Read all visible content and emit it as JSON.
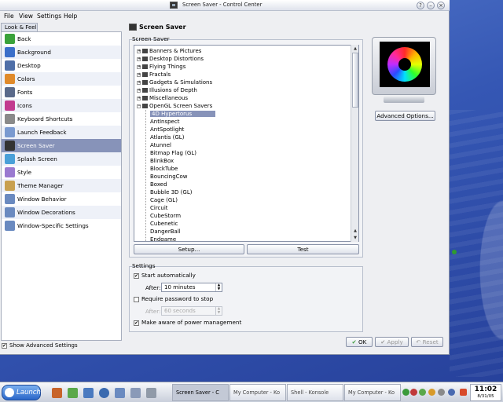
{
  "window": {
    "title": "Screen Saver - Control Center"
  },
  "menu": [
    "File",
    "View",
    "Settings",
    "Help"
  ],
  "sidebar": {
    "category_tab": "Look & Feel",
    "items": [
      {
        "label": "Back",
        "icon": "back-icon",
        "color": "#3aa23a"
      },
      {
        "label": "Background",
        "icon": "background-icon",
        "color": "#3b6fc9"
      },
      {
        "label": "Desktop",
        "icon": "desktop-icon",
        "color": "#4f6fa8"
      },
      {
        "label": "Colors",
        "icon": "colors-icon",
        "color": "#e08a2a"
      },
      {
        "label": "Fonts",
        "icon": "fonts-icon",
        "color": "#5a6a8a"
      },
      {
        "label": "Icons",
        "icon": "icons-icon",
        "color": "#c23a8e"
      },
      {
        "label": "Keyboard Shortcuts",
        "icon": "keyboard-icon",
        "color": "#8a8a8a"
      },
      {
        "label": "Launch Feedback",
        "icon": "launch-feedback-icon",
        "color": "#7a9ad0"
      },
      {
        "label": "Screen Saver",
        "icon": "screen-saver-icon",
        "color": "#333333",
        "selected": true
      },
      {
        "label": "Splash Screen",
        "icon": "splash-screen-icon",
        "color": "#4aa0d8"
      },
      {
        "label": "Style",
        "icon": "style-icon",
        "color": "#9a7ad0"
      },
      {
        "label": "Theme Manager",
        "icon": "theme-manager-icon",
        "color": "#c8a050"
      },
      {
        "label": "Window Behavior",
        "icon": "window-behavior-icon",
        "color": "#6a8ac0"
      },
      {
        "label": "Window Decorations",
        "icon": "window-decorations-icon",
        "color": "#6a8ac0"
      },
      {
        "label": "Window-Specific Settings",
        "icon": "window-specific-icon",
        "color": "#6a8ac0"
      }
    ],
    "show_advanced": "Show Advanced Settings"
  },
  "page": {
    "title": "Screen Saver"
  },
  "screensaver_group": {
    "label": "Screen Saver",
    "categories": [
      "Banners & Pictures",
      "Desktop Distortions",
      "Flying Things",
      "Fractals",
      "Gadgets & Simulations",
      "Illusions of Depth",
      "Miscellaneous",
      "OpenGL Screen Savers"
    ],
    "savers": [
      "4D Hypertorus",
      "AntInspect",
      "AntSpotlight",
      "Atlantis (GL)",
      "Atunnel",
      "Bitmap Flag (GL)",
      "BlinkBox",
      "BlockTube",
      "BouncingCow",
      "Boxed",
      "Bubble 3D (GL)",
      "Cage (GL)",
      "Circuit",
      "CubeStorm",
      "Cubenetic",
      "DangerBall",
      "Endgame"
    ],
    "setup_button": "Setup...",
    "test_button": "Test"
  },
  "advanced_options_button": "Advanced Options...",
  "settings_group": {
    "label": "Settings",
    "start_auto": "Start automatically",
    "after_label": "After:",
    "after_value": "10 minutes",
    "require_password": "Require password to stop",
    "pw_after_label": "After:",
    "pw_after_value": "60 seconds",
    "power_mgmt": "Make aware of power management"
  },
  "dialog_buttons": {
    "ok": "OK",
    "apply": "Apply",
    "reset": "Reset"
  },
  "taskbar": {
    "launch": "Launch",
    "tasks": [
      "Screen Saver - C",
      "My Computer - Ko",
      "Shell - Konsole",
      "My Computer - Ko"
    ],
    "clock_time": "11:02",
    "clock_date": "8/31/05"
  }
}
